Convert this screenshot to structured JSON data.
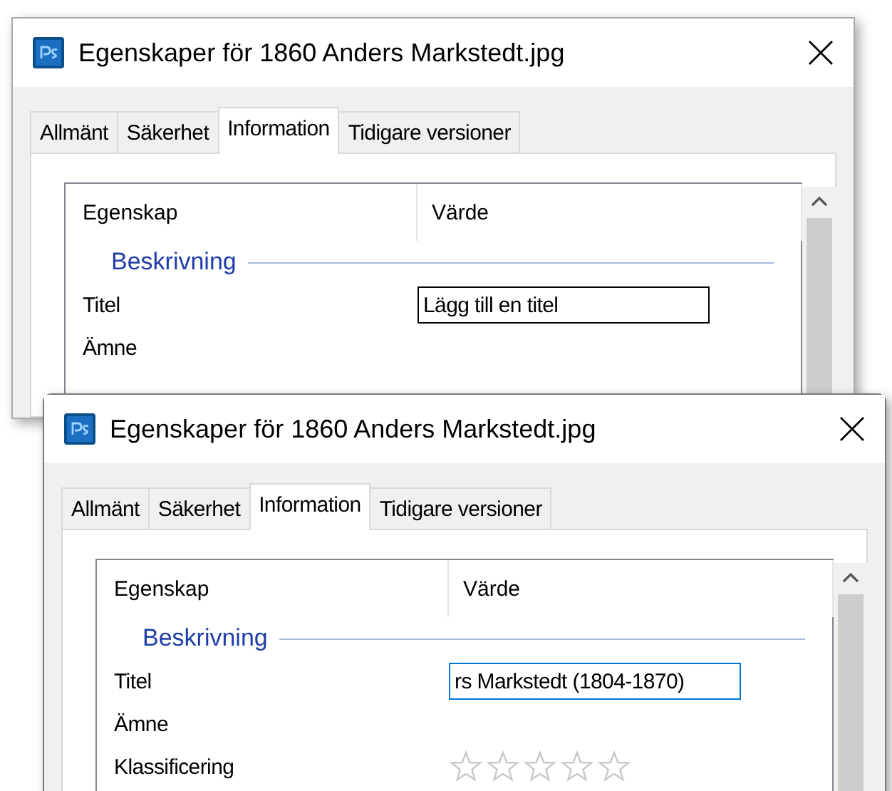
{
  "windows": [
    {
      "title": "Egenskaper för 1860 Anders Markstedt.jpg",
      "active": false,
      "tabs": [
        {
          "label": "Allmänt",
          "selected": false
        },
        {
          "label": "Säkerhet",
          "selected": false
        },
        {
          "label": "Information",
          "selected": true
        },
        {
          "label": "Tidigare versioner",
          "selected": false
        }
      ],
      "columns": [
        "Egenskap",
        "Värde"
      ],
      "group": "Beskrivning",
      "rows": [
        {
          "kind": "field",
          "name": "Titel",
          "placeholder": "Lägg till en titel",
          "focused": false
        },
        {
          "kind": "text",
          "name": "Ämne"
        }
      ]
    },
    {
      "title": "Egenskaper för 1860 Anders Markstedt.jpg",
      "active": true,
      "tabs": [
        {
          "label": "Allmänt",
          "selected": false
        },
        {
          "label": "Säkerhet",
          "selected": false
        },
        {
          "label": "Information",
          "selected": true
        },
        {
          "label": "Tidigare versioner",
          "selected": false
        }
      ],
      "columns": [
        "Egenskap",
        "Värde"
      ],
      "group": "Beskrivning",
      "rows": [
        {
          "kind": "field",
          "name": "Titel",
          "value": "rs Markstedt (1804-1870)",
          "focused": true
        },
        {
          "kind": "text",
          "name": "Ämne"
        },
        {
          "kind": "stars",
          "name": "Klassificering",
          "stars": 0
        }
      ]
    }
  ]
}
